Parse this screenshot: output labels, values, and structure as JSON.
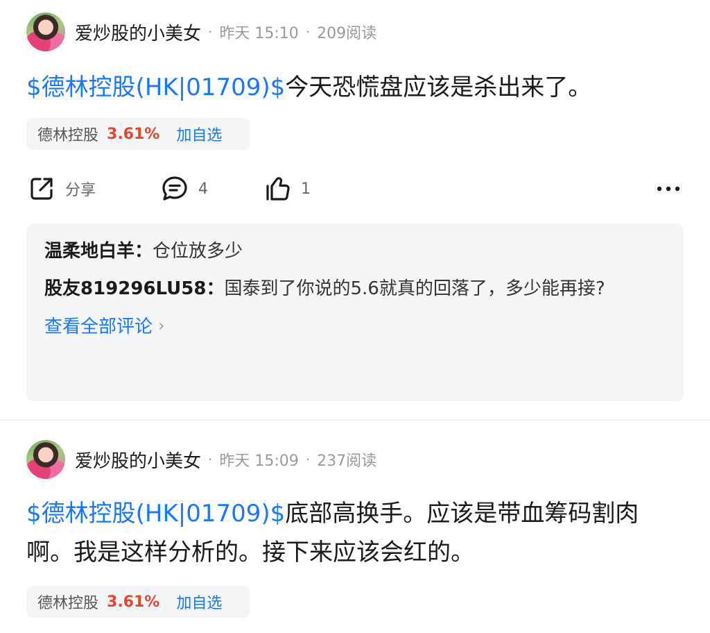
{
  "posts": [
    {
      "author": "爱炒股的小美女",
      "separator": "·",
      "time": "昨天 15:10",
      "reads": "209阅读",
      "tag": "$德林控股(HK|01709)$",
      "text": "今天恐慌盘应该是杀出来了。",
      "stock": {
        "name": "德林控股",
        "change": "3.61%",
        "add_label": "加自选"
      },
      "actions": {
        "share_label": "分享",
        "comment_count": "4",
        "like_count": "1",
        "more_icon": "more-icon"
      },
      "comments": [
        {
          "user": "温柔地白羊：",
          "text": "仓位放多少"
        },
        {
          "user": "股友819296LU58：",
          "text": "国泰到了你说的5.6就真的回落了，多少能再接?"
        }
      ],
      "view_all_label": "查看全部评论",
      "view_all_chevron": "›"
    },
    {
      "author": "爱炒股的小美女",
      "separator": "·",
      "time": "昨天 15:09",
      "reads": "237阅读",
      "tag": "$德林控股(HK|01709)$",
      "text": "底部高换手。应该是带血筹码割肉啊。我是这样分析的。接下来应该会红的。",
      "stock": {
        "name": "德林控股",
        "change": "3.61%",
        "add_label": "加自选"
      }
    }
  ],
  "colors": {
    "link": "#1677ff",
    "up": "#e8452e",
    "muted": "#9a9a9a",
    "panel": "#f4f5f7"
  }
}
